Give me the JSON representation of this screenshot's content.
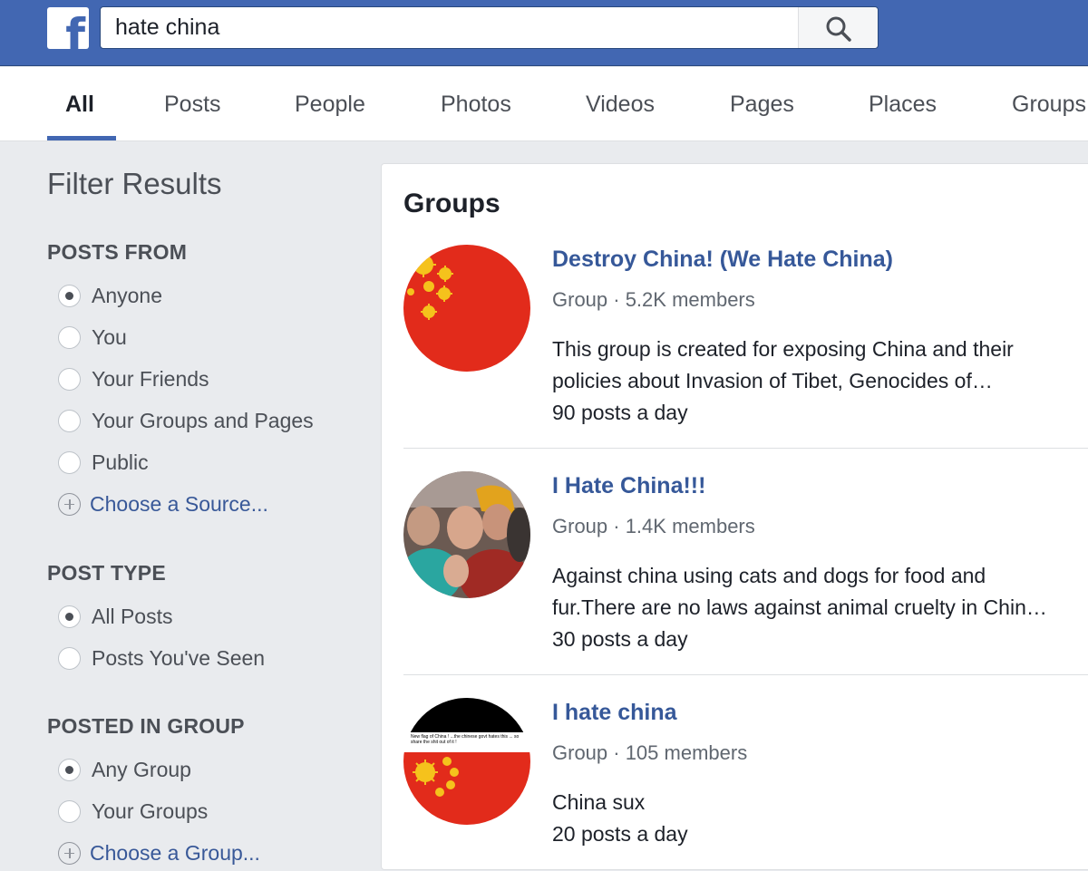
{
  "search": {
    "query": "hate china"
  },
  "tabs": [
    {
      "label": "All",
      "active": true
    },
    {
      "label": "Posts"
    },
    {
      "label": "People"
    },
    {
      "label": "Photos"
    },
    {
      "label": "Videos"
    },
    {
      "label": "Pages"
    },
    {
      "label": "Places"
    },
    {
      "label": "Groups"
    }
  ],
  "sidebar": {
    "title": "Filter Results",
    "posts_from": {
      "title": "POSTS FROM",
      "options": [
        "Anyone",
        "You",
        "Your Friends",
        "Your Groups and Pages",
        "Public"
      ],
      "selected": "Anyone",
      "link": "Choose a Source..."
    },
    "post_type": {
      "title": "POST TYPE",
      "options": [
        "All Posts",
        "Posts You've Seen"
      ],
      "selected": "All Posts"
    },
    "posted_in_group": {
      "title": "POSTED IN GROUP",
      "options": [
        "Any Group",
        "Your Groups"
      ],
      "selected": "Any Group",
      "link": "Choose a Group..."
    }
  },
  "results": {
    "title": "Groups",
    "groups": [
      {
        "name": "Destroy China! (We Hate China)",
        "meta": "Group · 5.2K members",
        "desc_line1": "This group is created for exposing China and their",
        "desc_line2": "policies about Invasion of Tibet, Genocides of…",
        "posts": "90 posts a day"
      },
      {
        "name": "I Hate China!!!",
        "meta": "Group · 1.4K members",
        "desc_line1": "Against china using cats and dogs for food and",
        "desc_line2": "fur.There are no laws against animal cruelty in Chin…",
        "posts": "30 posts a day"
      },
      {
        "name": "I hate china",
        "meta": "Group · 105 members",
        "desc_line1": "China sux",
        "posts": "20 posts a day",
        "image_caption": "New flag of China ! ...the chinese govt hates this ... so share the shit out of it !"
      }
    ]
  },
  "colors": {
    "brand": "#4267b2",
    "link": "#365899",
    "flag_red": "#e22b1b",
    "flag_yellow": "#f5c21c"
  }
}
